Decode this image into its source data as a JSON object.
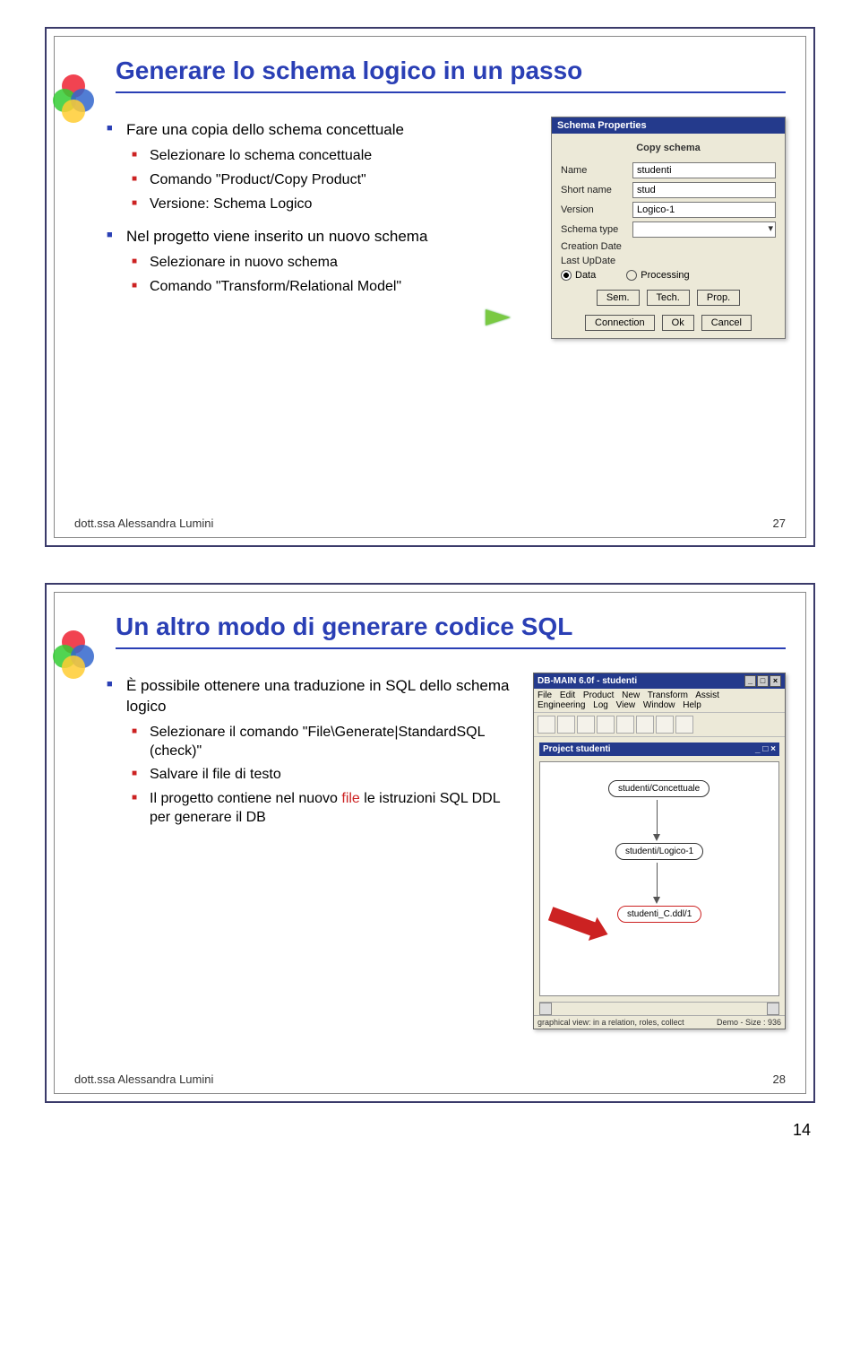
{
  "slide1": {
    "title": "Generare lo schema logico in un passo",
    "b1": "Fare una copia dello schema concettuale",
    "b1_1": "Selezionare lo schema concettuale",
    "b1_2": "Comando \"Product/Copy Product\"",
    "b1_3": "Versione: Schema Logico",
    "b2": "Nel progetto viene inserito un nuovo schema",
    "b2_1": "Selezionare in nuovo schema",
    "b2_2": "Comando \"Transform/Relational Model\"",
    "footer_author": "dott.ssa Alessandra Lumini",
    "footer_num": "27",
    "dialog": {
      "title": "Schema Properties",
      "heading": "Copy schema",
      "name_label": "Name",
      "name_val": "studenti",
      "short_label": "Short name",
      "short_val": "stud",
      "version_label": "Version",
      "version_val": "Logico-1",
      "type_label": "Schema type",
      "cdate_label": "Creation Date",
      "udate_label": "Last UpDate",
      "r_data": "Data",
      "r_proc": "Processing",
      "btn_sem": "Sem.",
      "btn_tech": "Tech.",
      "btn_prop": "Prop.",
      "btn_conn": "Connection",
      "btn_ok": "Ok",
      "btn_cancel": "Cancel"
    }
  },
  "slide2": {
    "title": "Un altro modo di generare codice SQL",
    "b1": "È possibile ottenere una traduzione in SQL dello schema logico",
    "b1_1": "Selezionare il comando \"File\\Generate|StandardSQL (check)\"",
    "b1_2": "Salvare il file di testo",
    "b1_3a": "Il progetto contiene nel nuovo ",
    "b1_3_file": "file",
    "b1_3b": " le istruzioni SQL DDL per generare il DB",
    "footer_author": "dott.ssa Alessandra Lumini",
    "footer_num": "28",
    "app": {
      "title": "DB-MAIN 6.0f - studenti",
      "menus": [
        "File",
        "Edit",
        "Product",
        "New",
        "Transform",
        "Assist",
        "Engineering",
        "Log",
        "View",
        "Window",
        "Help"
      ],
      "proj_title": "Project studenti",
      "node1": "studenti/Concettuale",
      "node2": "studenti/Logico-1",
      "node3": "studenti_C.ddl/1",
      "status_left": "graphical view: in a relation, roles, collect",
      "status_right": "Demo - Size : 936"
    }
  },
  "page_number": "14"
}
